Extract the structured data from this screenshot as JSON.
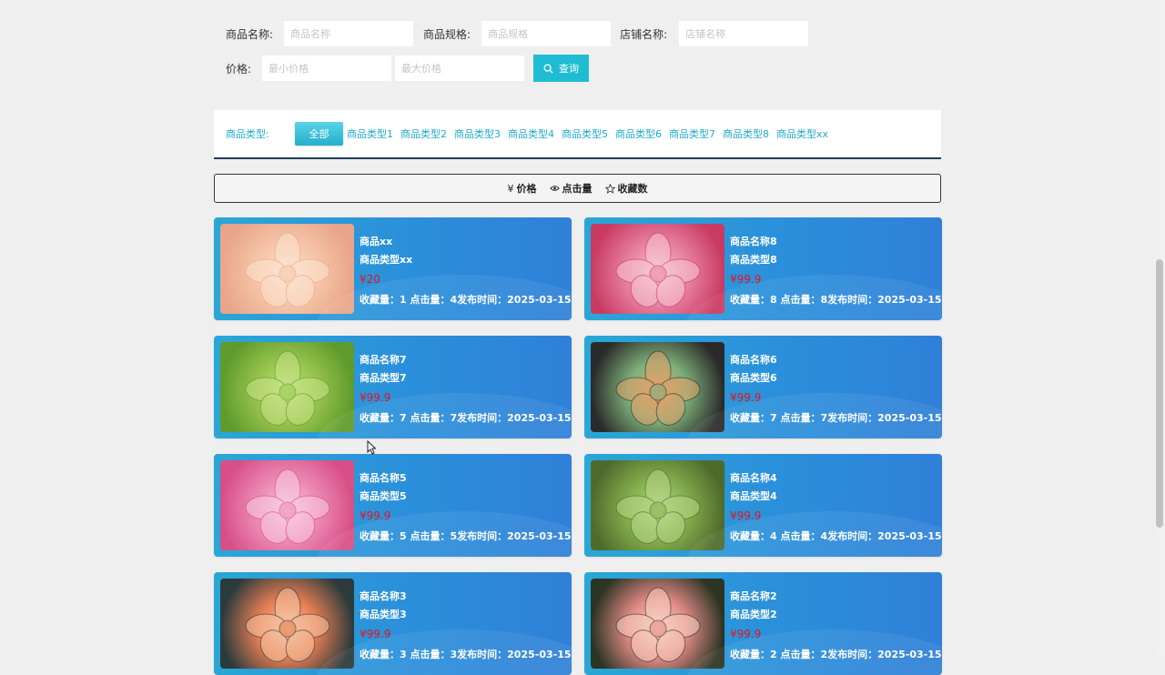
{
  "search": {
    "name_label": "商品名称:",
    "name_placeholder": "商品名称",
    "spec_label": "商品规格:",
    "spec_placeholder": "商品规格",
    "shop_label": "店铺名称:",
    "shop_placeholder": "店铺名称",
    "price_label": "价格:",
    "min_placeholder": "最小价格",
    "max_placeholder": "最大价格",
    "query_label": "查询"
  },
  "types": {
    "label": "商品类型:",
    "all": "全部",
    "items": [
      "商品类型1",
      "商品类型2",
      "商品类型3",
      "商品类型4",
      "商品类型5",
      "商品类型6",
      "商品类型7",
      "商品类型8",
      "商品类型xx"
    ]
  },
  "sort": {
    "price": "价格",
    "price_symbol": "¥",
    "clicks": "点击量",
    "favorites": "收藏数"
  },
  "products": [
    {
      "name": "商品xx",
      "type": "商品类型xx",
      "price": "¥20",
      "stats": "收藏量：1  点击量：4发布时间：2025-03-15",
      "colors": [
        "#e9a58a",
        "#f6c7a9",
        "#fde3d1"
      ]
    },
    {
      "name": "商品名称8",
      "type": "商品类型8",
      "price": "¥99.9",
      "stats": "收藏量：8  点击量：8发布时间：2025-03-15",
      "colors": [
        "#c93b63",
        "#e986a6",
        "#f7c8d6"
      ]
    },
    {
      "name": "商品名称7",
      "type": "商品类型7",
      "price": "¥99.9",
      "stats": "收藏量：7  点击量：7发布时间：2025-03-15",
      "colors": [
        "#5f9a2c",
        "#9bc64f",
        "#c9e38a"
      ]
    },
    {
      "name": "商品名称6",
      "type": "商品类型6",
      "price": "¥99.9",
      "stats": "收藏量：7  点击量：7发布时间：2025-03-15",
      "colors": [
        "#2a2a2a",
        "#7fb17a",
        "#e8a06a"
      ]
    },
    {
      "name": "商品名称5",
      "type": "商品类型5",
      "price": "¥99.9",
      "stats": "收藏量：5  点击量：5发布时间：2025-03-15",
      "colors": [
        "#d74f86",
        "#ee8fb8",
        "#f9cde0"
      ]
    },
    {
      "name": "商品名称4",
      "type": "商品类型4",
      "price": "¥99.9",
      "stats": "收藏量：4  点击量：4发布时间：2025-03-15",
      "colors": [
        "#4f6b2c",
        "#86b24f",
        "#b8d88c"
      ]
    },
    {
      "name": "商品名称3",
      "type": "商品类型3",
      "price": "¥99.9",
      "stats": "收藏量：3  点击量：3发布时间：2025-03-15",
      "colors": [
        "#2b3a3a",
        "#e87f54",
        "#f6c6a6"
      ]
    },
    {
      "name": "商品名称2",
      "type": "商品类型2",
      "price": "¥99.9",
      "stats": "收藏量：2  点击量：2发布时间：2025-03-15",
      "colors": [
        "#2c3423",
        "#e38c88",
        "#f7d2c4"
      ]
    }
  ]
}
